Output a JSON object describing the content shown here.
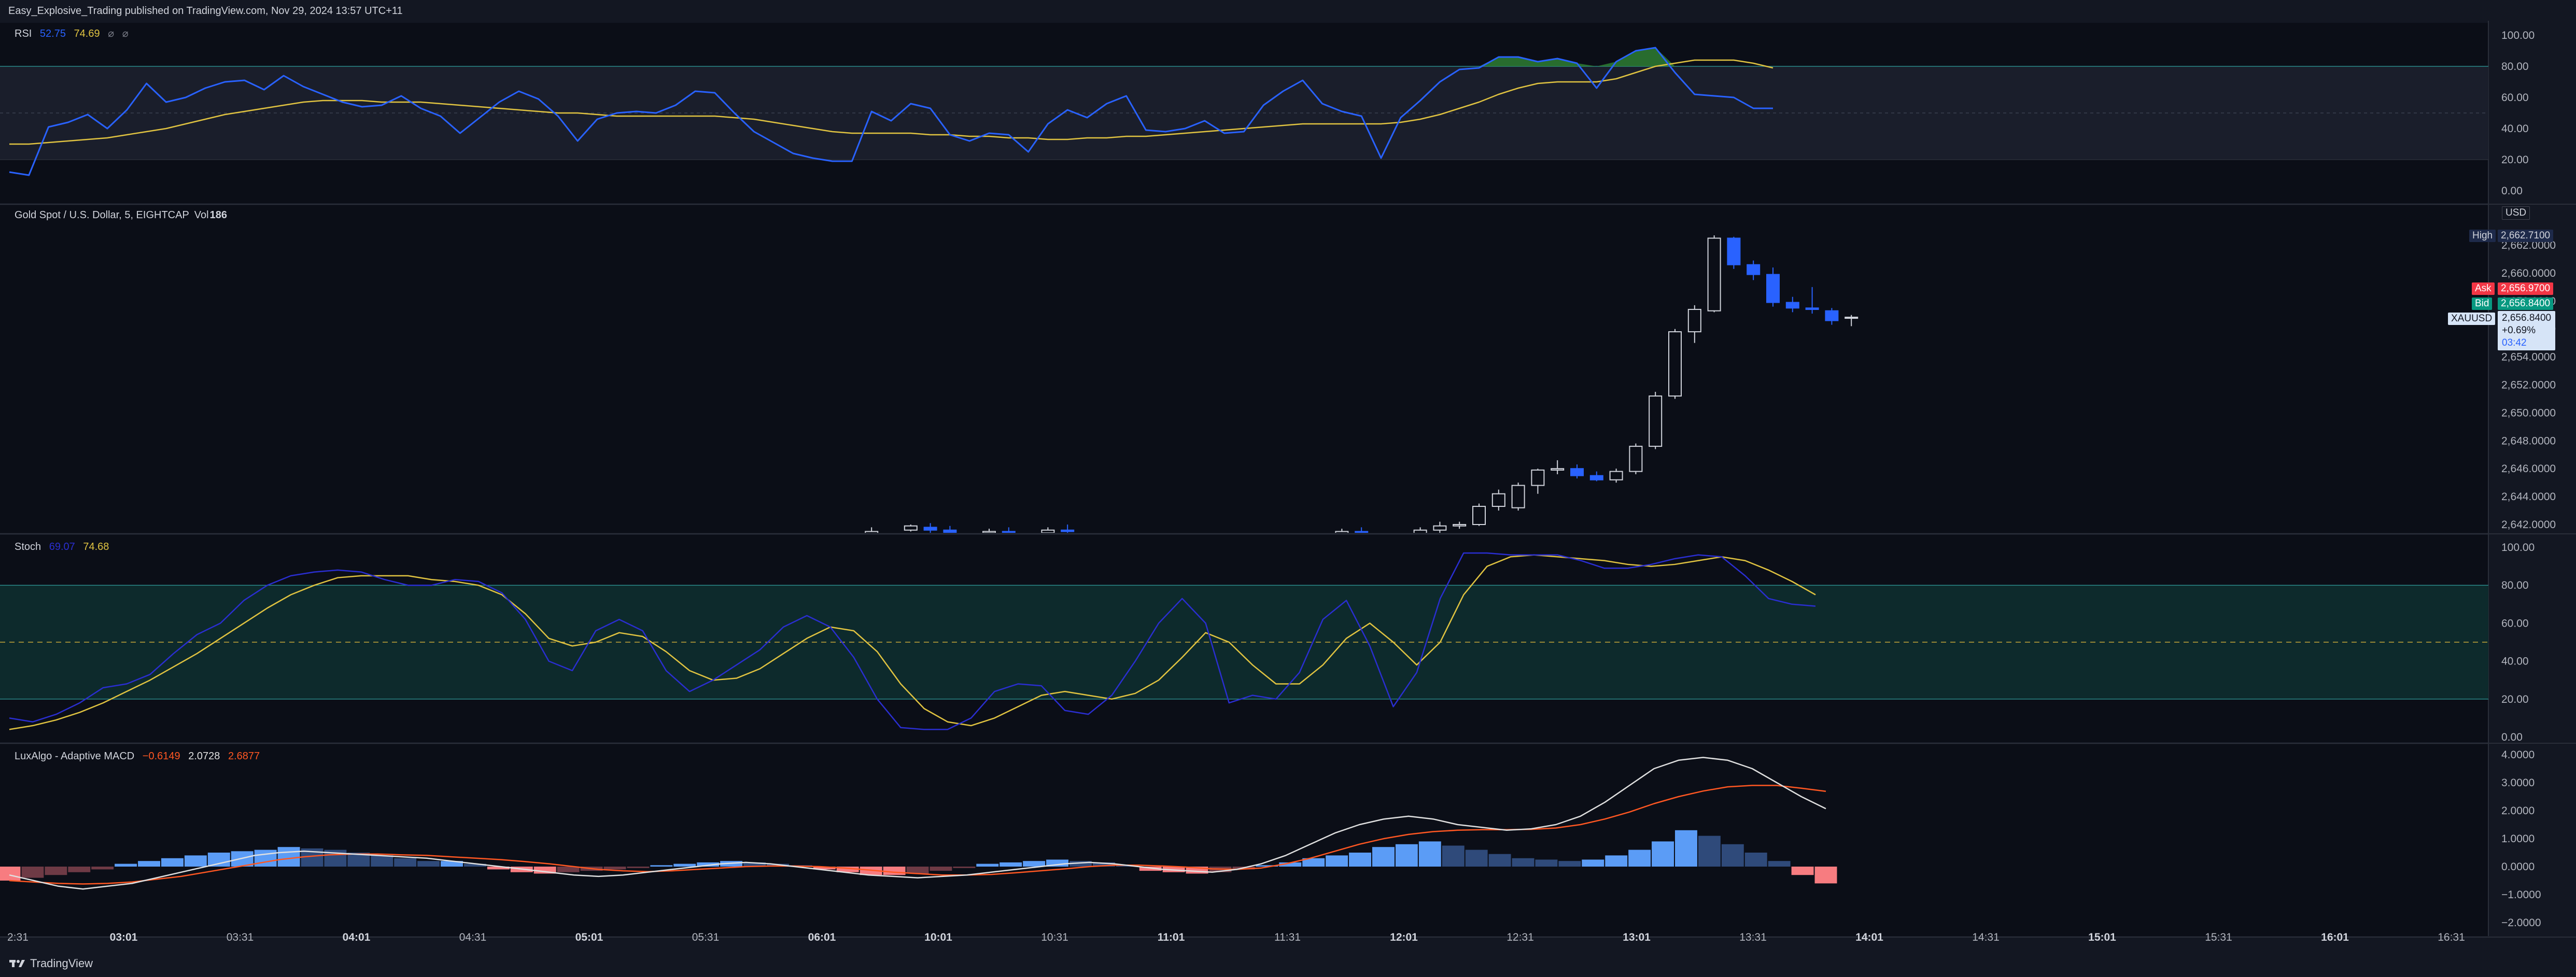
{
  "header": {
    "publisher": "Easy_Explosive_Trading published on TradingView.com, Nov 29, 2024 13:57 UTC+11"
  },
  "footer": {
    "brand": "TradingView",
    "icon": "tradingview-logo"
  },
  "colors": {
    "bg": "#131722",
    "pane_bg": "#0b0e17",
    "up_border": "#d1d4dc",
    "down": "#2962ff",
    "rsi": "#2962ff",
    "rsi_ma": "#e0c341",
    "stoch_k": "#2a2ed1",
    "stoch_d": "#e0c341",
    "macd_line": "#e0e0e0",
    "signal_line": "#ff5722",
    "ask": "#f23645",
    "bid": "#089981"
  },
  "panes": {
    "rsi": {
      "legend": {
        "name": "RSI",
        "v1": "52.75",
        "v2": "74.69",
        "sym1": "⌀",
        "sym2": "⌀"
      },
      "scale": [
        "100.00",
        "80.00",
        "60.00",
        "40.00",
        "20.00",
        "0.00"
      ],
      "bands": {
        "upper": 80,
        "middle": 50,
        "lower": 20
      },
      "rsi": [
        12,
        10,
        41,
        44,
        49,
        40,
        52,
        69,
        57,
        60,
        66,
        70,
        71,
        65,
        74,
        67,
        62,
        57,
        54,
        55,
        61,
        53,
        48,
        37,
        47,
        57,
        64,
        59,
        48,
        32,
        46,
        50,
        51,
        50,
        55,
        64,
        63,
        50,
        38,
        31,
        24,
        21,
        19,
        19,
        51,
        45,
        56,
        53,
        36,
        32,
        37,
        36,
        25,
        43,
        52,
        47,
        56,
        61,
        39,
        38,
        40,
        45,
        37,
        38,
        55,
        64,
        71,
        56,
        51,
        48,
        21,
        47,
        58,
        70,
        78,
        79,
        86,
        86,
        83,
        85,
        82,
        66,
        83,
        90,
        92,
        76,
        62,
        61,
        60,
        53,
        53
      ],
      "rsi_ma": [
        30,
        30,
        31,
        32,
        33,
        34,
        36,
        38,
        40,
        43,
        46,
        49,
        51,
        53,
        55,
        57,
        58,
        58,
        58,
        57,
        57,
        57,
        56,
        55,
        54,
        53,
        52,
        51,
        50,
        50,
        49,
        48,
        48,
        48,
        48,
        48,
        48,
        47,
        46,
        44,
        42,
        40,
        38,
        37,
        37,
        37,
        37,
        36,
        36,
        35,
        35,
        34,
        34,
        33,
        33,
        34,
        34,
        35,
        35,
        36,
        37,
        38,
        39,
        40,
        41,
        42,
        43,
        43,
        43,
        43,
        43,
        44,
        46,
        49,
        53,
        57,
        62,
        66,
        69,
        70,
        70,
        70,
        72,
        76,
        80,
        82,
        84,
        84,
        84,
        82,
        79
      ]
    },
    "price": {
      "legend": {
        "symbol": "Gold Spot / U.S. Dollar, 5, EIGHTCAP",
        "vol_label": "Vol",
        "vol": "186"
      },
      "currency": "USD",
      "scale": [
        "2,662.0000",
        "2,660.0000",
        "2,658.0000",
        "2,656.0000",
        "2,654.0000",
        "2,652.0000",
        "2,650.0000",
        "2,648.0000",
        "2,646.0000",
        "2,644.0000",
        "2,642.0000"
      ],
      "tags": {
        "high_label": "High",
        "high_value": "2,662.7100",
        "ask_label": "Ask",
        "ask_value": "2,656.9700",
        "bid_label": "Bid",
        "bid_value": "2,656.8400",
        "sym_label": "XAUUSD",
        "last_value": "2,656.8400",
        "change": "+0.69%",
        "countdown": "03:42"
      },
      "candles": [
        {
          "i": 44,
          "o": 2641.2,
          "h": 2641.8,
          "l": 2641.0,
          "c": 2641.5
        },
        {
          "i": 46,
          "o": 2641.6,
          "h": 2642.0,
          "l": 2641.5,
          "c": 2641.9
        },
        {
          "i": 47,
          "o": 2641.8,
          "h": 2642.1,
          "l": 2641.4,
          "c": 2641.6
        },
        {
          "i": 48,
          "o": 2641.6,
          "h": 2641.9,
          "l": 2641.3,
          "c": 2641.4
        },
        {
          "i": 50,
          "o": 2641.4,
          "h": 2641.7,
          "l": 2641.2,
          "c": 2641.5
        },
        {
          "i": 51,
          "o": 2641.5,
          "h": 2641.8,
          "l": 2641.3,
          "c": 2641.4
        },
        {
          "i": 53,
          "o": 2641.4,
          "h": 2641.8,
          "l": 2641.2,
          "c": 2641.6
        },
        {
          "i": 54,
          "o": 2641.6,
          "h": 2642.0,
          "l": 2641.4,
          "c": 2641.5
        },
        {
          "i": 68,
          "o": 2641.3,
          "h": 2641.7,
          "l": 2641.0,
          "c": 2641.5
        },
        {
          "i": 69,
          "o": 2641.5,
          "h": 2641.8,
          "l": 2641.3,
          "c": 2641.4
        },
        {
          "i": 72,
          "o": 2641.2,
          "h": 2641.8,
          "l": 2641.0,
          "c": 2641.6
        },
        {
          "i": 73,
          "o": 2641.6,
          "h": 2642.2,
          "l": 2641.4,
          "c": 2641.9
        },
        {
          "i": 74,
          "o": 2641.9,
          "h": 2642.2,
          "l": 2641.7,
          "c": 2642.0
        },
        {
          "i": 75,
          "o": 2642.0,
          "h": 2643.5,
          "l": 2641.9,
          "c": 2643.3
        },
        {
          "i": 76,
          "o": 2643.3,
          "h": 2644.5,
          "l": 2643.0,
          "c": 2644.2
        },
        {
          "i": 77,
          "o": 2643.2,
          "h": 2645.0,
          "l": 2643.0,
          "c": 2644.8
        },
        {
          "i": 78,
          "o": 2644.8,
          "h": 2646.0,
          "l": 2644.2,
          "c": 2645.9
        },
        {
          "i": 79,
          "o": 2645.9,
          "h": 2646.6,
          "l": 2645.6,
          "c": 2646.0
        },
        {
          "i": 80,
          "o": 2646.0,
          "h": 2646.3,
          "l": 2645.3,
          "c": 2645.5
        },
        {
          "i": 81,
          "o": 2645.5,
          "h": 2645.8,
          "l": 2645.1,
          "c": 2645.2
        },
        {
          "i": 82,
          "o": 2645.2,
          "h": 2646.0,
          "l": 2645.0,
          "c": 2645.8
        },
        {
          "i": 83,
          "o": 2645.8,
          "h": 2647.8,
          "l": 2645.6,
          "c": 2647.6
        },
        {
          "i": 84,
          "o": 2647.6,
          "h": 2651.5,
          "l": 2647.4,
          "c": 2651.2
        },
        {
          "i": 85,
          "o": 2651.2,
          "h": 2656.0,
          "l": 2651.0,
          "c": 2655.8
        },
        {
          "i": 86,
          "o": 2655.8,
          "h": 2657.7,
          "l": 2655.0,
          "c": 2657.4
        },
        {
          "i": 87,
          "o": 2657.3,
          "h": 2662.7,
          "l": 2657.2,
          "c": 2662.5
        },
        {
          "i": 88,
          "o": 2662.5,
          "h": 2662.6,
          "l": 2660.3,
          "c": 2660.6
        },
        {
          "i": 89,
          "o": 2660.6,
          "h": 2660.9,
          "l": 2659.5,
          "c": 2659.9
        },
        {
          "i": 90,
          "o": 2659.9,
          "h": 2660.4,
          "l": 2657.6,
          "c": 2657.9
        },
        {
          "i": 91,
          "o": 2657.9,
          "h": 2658.3,
          "l": 2657.2,
          "c": 2657.5
        },
        {
          "i": 92,
          "o": 2657.5,
          "h": 2659.0,
          "l": 2657.1,
          "c": 2657.4
        },
        {
          "i": 93,
          "o": 2657.3,
          "h": 2657.5,
          "l": 2656.3,
          "c": 2656.6
        },
        {
          "i": 94,
          "o": 2656.8,
          "h": 2657.0,
          "l": 2656.2,
          "c": 2656.84
        }
      ]
    },
    "stoch": {
      "legend": {
        "name": "Stoch",
        "k": "69.07",
        "d": "74.68"
      },
      "scale": [
        "100.00",
        "80.00",
        "60.00",
        "40.00",
        "20.00",
        "0.00"
      ],
      "bands": {
        "upper": 80,
        "middle": 50,
        "lower": 20
      },
      "k": [
        10,
        8,
        12,
        18,
        26,
        28,
        33,
        44,
        54,
        60,
        72,
        80,
        85,
        87,
        88,
        87,
        83,
        80,
        80,
        83,
        82,
        76,
        62,
        40,
        35,
        56,
        62,
        56,
        35,
        24,
        30,
        38,
        46,
        58,
        64,
        58,
        42,
        20,
        5,
        4,
        4,
        10,
        24,
        28,
        27,
        14,
        12,
        22,
        40,
        60,
        73,
        60,
        18,
        22,
        20,
        34,
        62,
        72,
        48,
        16,
        34,
        73,
        97,
        97,
        96,
        96,
        96,
        93,
        89,
        89,
        91,
        94,
        96,
        95,
        85,
        73,
        70,
        69
      ],
      "d": [
        4,
        6,
        9,
        13,
        18,
        24,
        30,
        37,
        44,
        52,
        60,
        68,
        75,
        80,
        84,
        85,
        85,
        85,
        83,
        82,
        80,
        75,
        65,
        52,
        48,
        50,
        55,
        53,
        45,
        35,
        30,
        31,
        36,
        44,
        52,
        58,
        56,
        45,
        28,
        15,
        8,
        6,
        10,
        16,
        22,
        24,
        22,
        20,
        23,
        30,
        42,
        55,
        50,
        38,
        28,
        28,
        38,
        52,
        60,
        50,
        38,
        50,
        75,
        90,
        95,
        96,
        95,
        94,
        93,
        91,
        90,
        91,
        93,
        95,
        93,
        88,
        82,
        75
      ]
    },
    "macd": {
      "legend": {
        "name": "LuxAlgo - Adaptive MACD",
        "hist": "−0.6149",
        "macd": "2.0728",
        "signal": "2.6877"
      },
      "scale": [
        "4.0000",
        "3.0000",
        "2.0000",
        "1.0000",
        "0.0000",
        "−1.0000",
        "−2.0000"
      ],
      "hist": [
        -0.5,
        -0.4,
        -0.3,
        -0.2,
        -0.1,
        0.1,
        0.2,
        0.3,
        0.4,
        0.5,
        0.55,
        0.6,
        0.7,
        0.65,
        0.6,
        0.5,
        0.4,
        0.3,
        0.2,
        0.2,
        0.1,
        -0.1,
        -0.2,
        -0.25,
        -0.2,
        -0.15,
        -0.1,
        -0.05,
        0.05,
        0.1,
        0.15,
        0.2,
        0.15,
        0.1,
        0.05,
        -0.1,
        -0.2,
        -0.3,
        -0.3,
        -0.25,
        -0.15,
        -0.05,
        0.1,
        0.15,
        0.2,
        0.25,
        0.2,
        0.15,
        0.05,
        -0.15,
        -0.2,
        -0.25,
        -0.2,
        -0.1,
        0.05,
        0.15,
        0.3,
        0.4,
        0.5,
        0.7,
        0.8,
        0.9,
        0.75,
        0.6,
        0.45,
        0.3,
        0.25,
        0.2,
        0.25,
        0.4,
        0.6,
        0.9,
        1.3,
        1.1,
        0.8,
        0.5,
        0.2,
        -0.3,
        -0.6
      ],
      "macd_line": [
        -0.3,
        -0.5,
        -0.7,
        -0.8,
        -0.7,
        -0.6,
        -0.4,
        -0.2,
        0.0,
        0.2,
        0.4,
        0.5,
        0.55,
        0.5,
        0.45,
        0.4,
        0.35,
        0.3,
        0.2,
        0.1,
        0.0,
        -0.1,
        -0.2,
        -0.3,
        -0.35,
        -0.3,
        -0.2,
        -0.1,
        0.0,
        0.1,
        0.15,
        0.1,
        0.0,
        -0.1,
        -0.2,
        -0.3,
        -0.35,
        -0.4,
        -0.35,
        -0.3,
        -0.2,
        -0.1,
        0.0,
        0.1,
        0.15,
        0.1,
        0.0,
        -0.1,
        -0.15,
        -0.2,
        -0.1,
        0.1,
        0.4,
        0.8,
        1.2,
        1.5,
        1.7,
        1.8,
        1.7,
        1.5,
        1.4,
        1.3,
        1.35,
        1.5,
        1.8,
        2.3,
        2.9,
        3.5,
        3.8,
        3.9,
        3.8,
        3.5,
        3.0,
        2.5,
        2.07
      ],
      "signal_line": [
        -0.5,
        -0.55,
        -0.6,
        -0.62,
        -0.6,
        -0.55,
        -0.45,
        -0.35,
        -0.2,
        -0.05,
        0.1,
        0.25,
        0.35,
        0.42,
        0.45,
        0.45,
        0.42,
        0.4,
        0.35,
        0.3,
        0.25,
        0.18,
        0.1,
        0.0,
        -0.1,
        -0.15,
        -0.18,
        -0.15,
        -0.1,
        -0.05,
        0.0,
        0.02,
        0.02,
        0.0,
        -0.05,
        -0.12,
        -0.2,
        -0.25,
        -0.3,
        -0.3,
        -0.28,
        -0.22,
        -0.15,
        -0.08,
        0.0,
        0.05,
        0.05,
        0.02,
        -0.02,
        -0.08,
        -0.1,
        -0.05,
        0.1,
        0.3,
        0.55,
        0.8,
        1.0,
        1.15,
        1.25,
        1.3,
        1.32,
        1.32,
        1.33,
        1.38,
        1.5,
        1.7,
        1.95,
        2.25,
        2.5,
        2.7,
        2.85,
        2.9,
        2.9,
        2.8,
        2.69
      ]
    }
  },
  "time_axis": {
    "ticks": [
      {
        "t": "2:31",
        "bold": false
      },
      {
        "t": "03:01",
        "bold": true
      },
      {
        "t": "03:31",
        "bold": false
      },
      {
        "t": "04:01",
        "bold": true
      },
      {
        "t": "04:31",
        "bold": false
      },
      {
        "t": "05:01",
        "bold": true
      },
      {
        "t": "05:31",
        "bold": false
      },
      {
        "t": "06:01",
        "bold": true
      },
      {
        "t": "10:01",
        "bold": true
      },
      {
        "t": "10:31",
        "bold": false
      },
      {
        "t": "11:01",
        "bold": true
      },
      {
        "t": "11:31",
        "bold": false
      },
      {
        "t": "12:01",
        "bold": true
      },
      {
        "t": "12:31",
        "bold": false
      },
      {
        "t": "13:01",
        "bold": true
      },
      {
        "t": "13:31",
        "bold": false
      },
      {
        "t": "14:01",
        "bold": true
      },
      {
        "t": "14:31",
        "bold": false
      },
      {
        "t": "15:01",
        "bold": true
      },
      {
        "t": "15:31",
        "bold": false
      },
      {
        "t": "16:01",
        "bold": true
      },
      {
        "t": "16:31",
        "bold": false
      }
    ]
  }
}
